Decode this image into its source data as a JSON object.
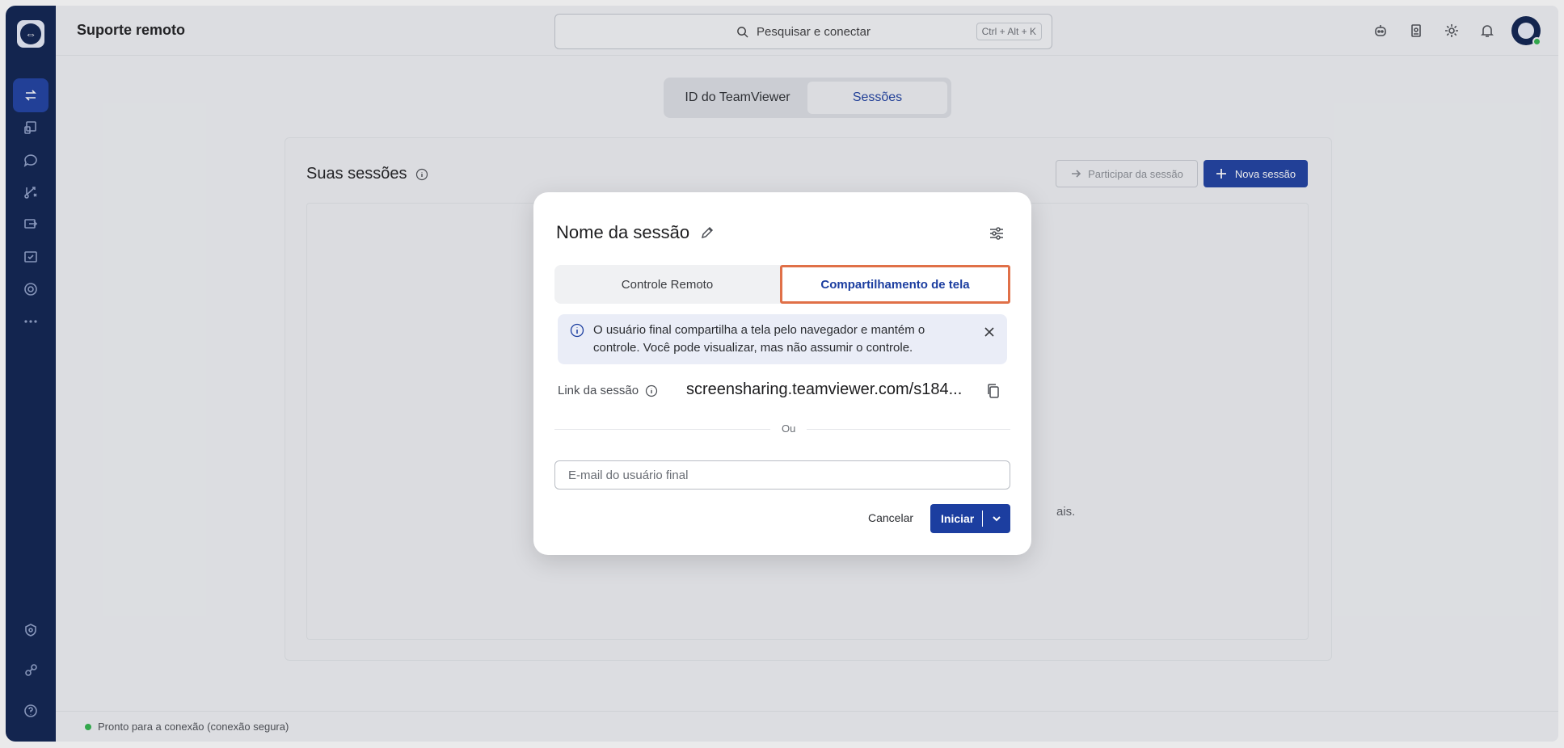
{
  "app": {
    "title": "Suporte remoto"
  },
  "search": {
    "placeholder": "Pesquisar e conectar",
    "shortcut": "Ctrl + Alt + K"
  },
  "top_icons": [
    "assistant-icon",
    "contacts-icon",
    "gear-icon",
    "bell-icon",
    "avatar"
  ],
  "sidebar": {
    "items": [
      {
        "icon": "remote-support-icon",
        "active": true
      },
      {
        "icon": "devices-icon"
      },
      {
        "icon": "chat-icon"
      },
      {
        "icon": "workflow-icon"
      },
      {
        "icon": "sessions-icon"
      },
      {
        "icon": "tasks-icon"
      },
      {
        "icon": "globe-icon"
      },
      {
        "icon": "more-icon"
      }
    ],
    "bottom": [
      {
        "icon": "settings-shield-icon"
      },
      {
        "icon": "integrations-icon"
      },
      {
        "icon": "help-icon"
      }
    ]
  },
  "segment": {
    "tabs": [
      "ID do TeamViewer",
      "Sessões"
    ],
    "active": "Sessões"
  },
  "sessions": {
    "title": "Suas sessões",
    "join_label": "Participar da sessão",
    "new_label": "Nova sessão",
    "hint_fragment": "ais."
  },
  "status": {
    "text": "Pronto para a conexão (conexão segura)",
    "color": "#2fb34a"
  },
  "modal": {
    "title": "Nome da sessão",
    "tabs": {
      "remote": "Controle Remoto",
      "screen": "Compartilhamento de tela"
    },
    "active_tab": "Compartilhamento de tela",
    "info": "O usuário final compartilha a tela pelo navegador e mantém o controle. Você pode visualizar, mas não assumir o controle.",
    "link_label": "Link da sessão",
    "link_value": "screensharing.teamviewer.com/s184...",
    "or": "Ou",
    "email_placeholder": "E-mail do usuário final",
    "email_value": "",
    "cancel": "Cancelar",
    "start": "Iniciar"
  },
  "colors": {
    "accent": "#1c3ea0",
    "rail": "#0b1f4e",
    "highlight": "#e07048"
  }
}
